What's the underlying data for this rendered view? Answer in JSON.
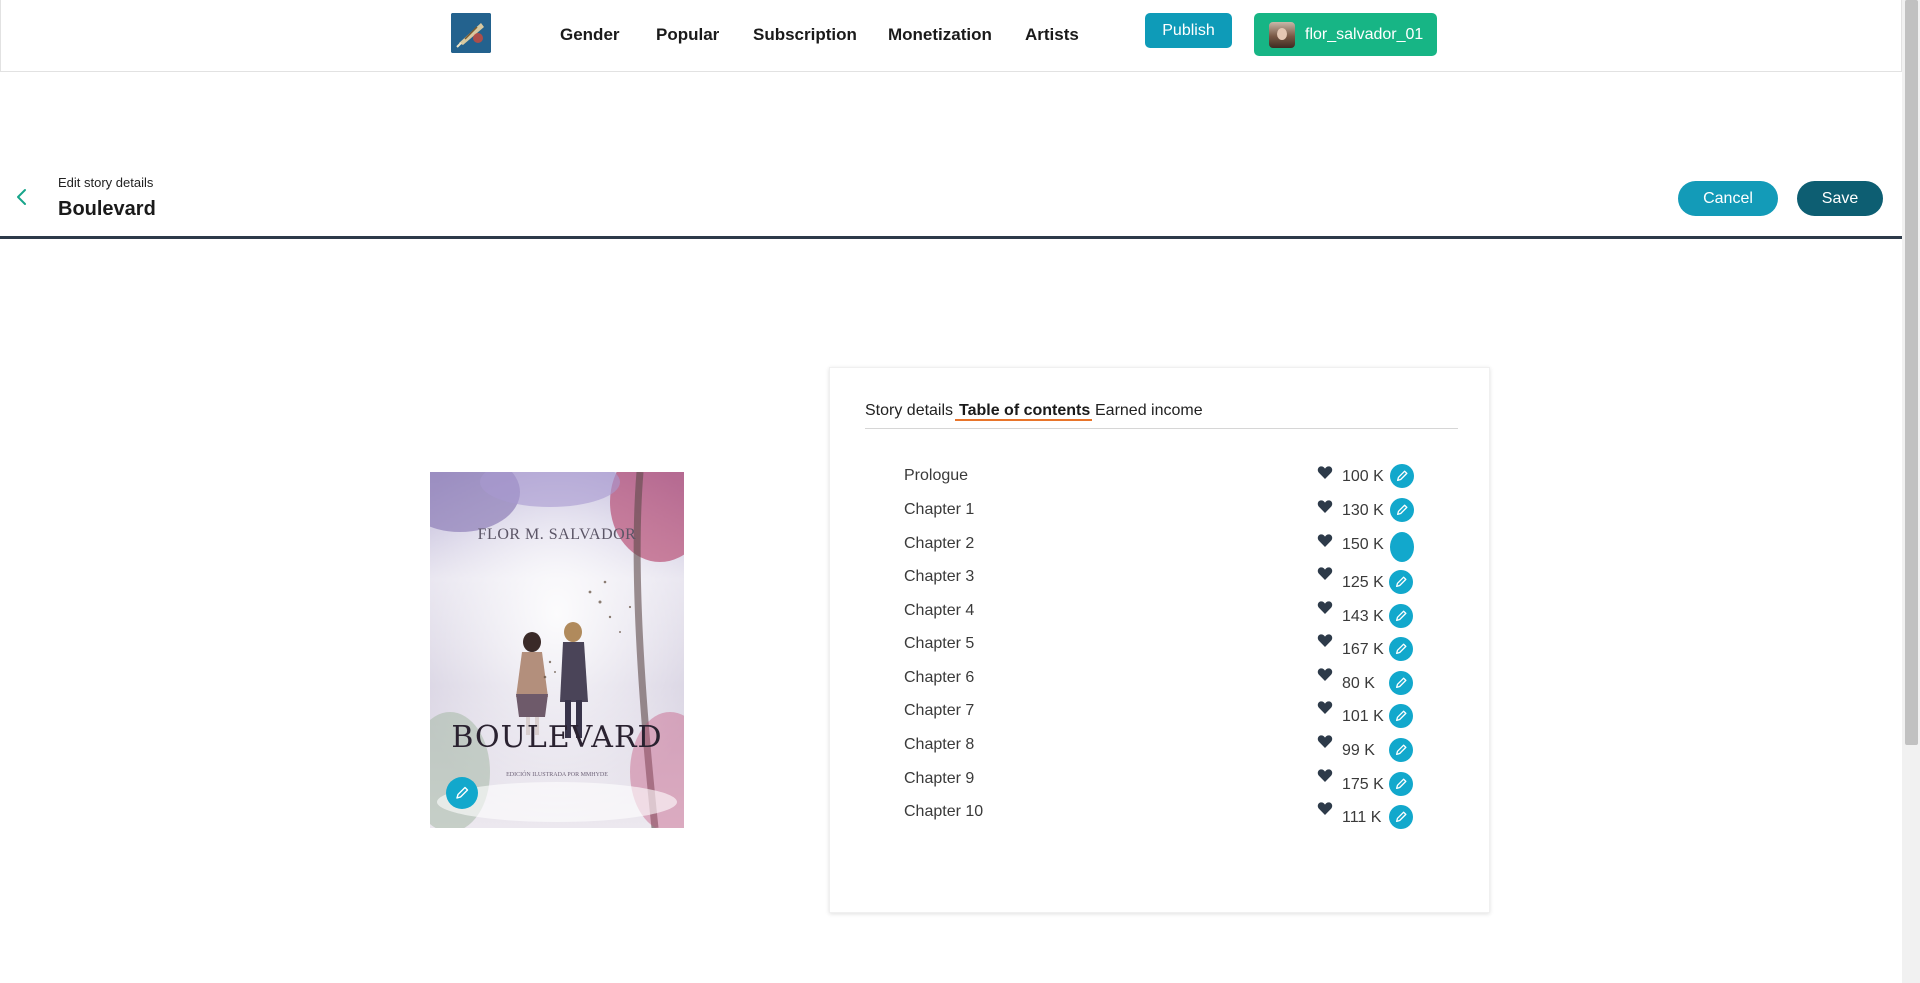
{
  "navbar": {
    "logo_icon": "feather-pen-logo-icon",
    "links": [
      {
        "label": "Gender"
      },
      {
        "label": "Popular"
      },
      {
        "label": "Subscription"
      },
      {
        "label": "Monetization"
      },
      {
        "label": "Artists"
      }
    ],
    "publish_label": "Publish",
    "username": "flor_salvador_01",
    "colors": {
      "publish": "#0e9bb8",
      "user": "#17b585"
    }
  },
  "header": {
    "back_icon": "chevron-left-icon",
    "edit_label": "Edit story details",
    "title": "Boulevard",
    "cancel_label": "Cancel",
    "save_label": "Save",
    "colors": {
      "cancel": "#139bb8",
      "save": "#0d5e72"
    }
  },
  "cover": {
    "author": "FLOR M. SALVADOR",
    "title": "BOULEVARD",
    "subtitle": "EDICIÓN ILUSTRADA POR MMHYDE",
    "edit_icon": "pencil-icon"
  },
  "tabs": [
    {
      "label": "Story details",
      "active": false
    },
    {
      "label": "Table of contents",
      "active": true
    },
    {
      "label": "Earned income",
      "active": false
    }
  ],
  "chapters": [
    {
      "name": "Prologue",
      "likes": "100 K"
    },
    {
      "name": "Chapter 1",
      "likes": "130 K"
    },
    {
      "name": "Chapter 2",
      "likes": "150 K"
    },
    {
      "name": "Chapter 3",
      "likes": "125 K"
    },
    {
      "name": "Chapter 4",
      "likes": "143 K"
    },
    {
      "name": "Chapter 5",
      "likes": "167 K"
    },
    {
      "name": "Chapter 6",
      "likes": "80 K"
    },
    {
      "name": "Chapter 7",
      "likes": "101 K"
    },
    {
      "name": "Chapter 8",
      "likes": "99 K"
    },
    {
      "name": "Chapter 9",
      "likes": "175 K"
    },
    {
      "name": "Chapter 10",
      "likes": "111 K"
    }
  ],
  "accent_colors": {
    "tab_underline": "#e8742a",
    "edit_button": "#12a8cc",
    "heart": "#2d3a49"
  }
}
